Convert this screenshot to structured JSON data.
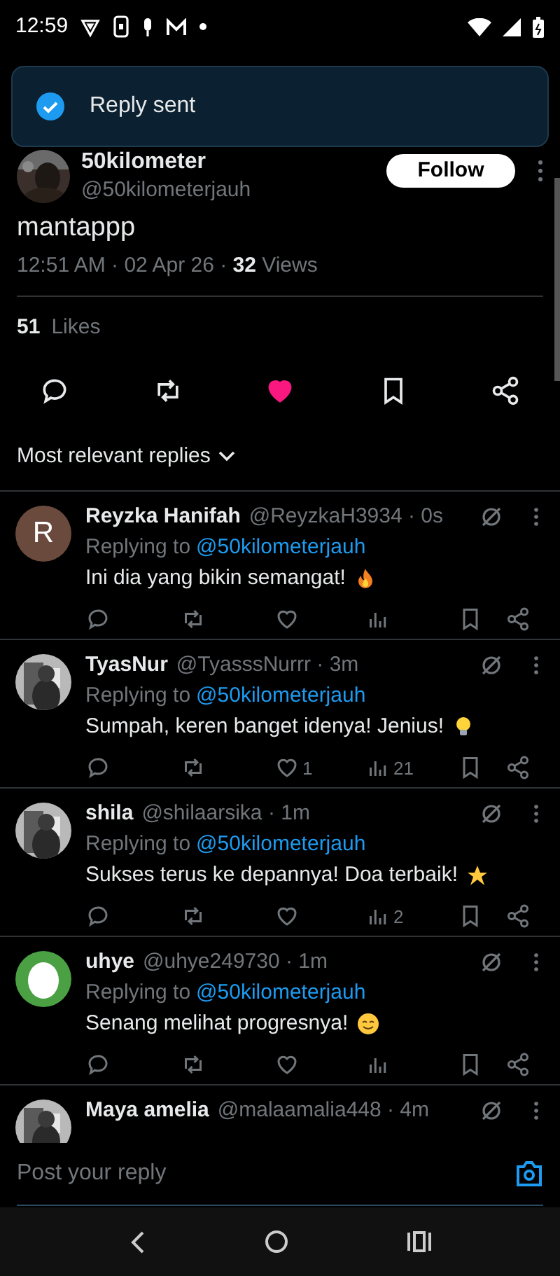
{
  "status_bar": {
    "time": "12:59"
  },
  "toast": {
    "text": "Reply sent",
    "success": true
  },
  "post": {
    "author_name": "50kilometer",
    "handle": "@50kilometerjauh",
    "follow_label": "Follow",
    "text": "mantappp",
    "meta": "12:51 AM · 02 Apr 26 · ",
    "views_count": "32",
    "views_label": " Views",
    "likes_count": "51",
    "likes_label": "Likes",
    "liked": true,
    "bookmarked": false
  },
  "sort": {
    "label": "Most relevant replies"
  },
  "replies": [
    {
      "name": "Reyzka Hanifah",
      "handle": "@ReyzkaH3934 · 0s",
      "avatar": {
        "kind": "letter",
        "letter": "R"
      },
      "replying_to": "Replying to",
      "mention": "@50kilometerjauh",
      "text": "Ini dia yang bikin semangat!",
      "emoji": {
        "kind": "fire"
      }
    },
    {
      "name": "TyasNur",
      "handle": "@TyasssNurrr · 3m",
      "replying_to": "Replying to",
      "mention": "@50kilometerjauh",
      "text": "Sumpah, keren banget idenya! Jenius!",
      "emoji": {
        "kind": "bulb"
      },
      "likes": "1",
      "views": "21"
    },
    {
      "name": "shila",
      "handle": "@shilaarsika · 1m",
      "replying_to": "Replying to",
      "mention": "@50kilometerjauh",
      "text": "Sukses terus ke depannya! Doa terbaik!",
      "emoji": {
        "kind": "star"
      },
      "views": "2"
    },
    {
      "name": "uhye",
      "handle": "@uhye249730 · 1m",
      "avatar": {
        "kind": "egg"
      },
      "replying_to": "Replying to",
      "mention": "@50kilometerjauh",
      "text": "Senang melihat progresnya!",
      "emoji": {
        "kind": "smile"
      }
    },
    {
      "name": "Maya amelia",
      "handle": "@malaamalia448 · 4m"
    }
  ],
  "composer": {
    "placeholder": "Post your reply"
  }
}
